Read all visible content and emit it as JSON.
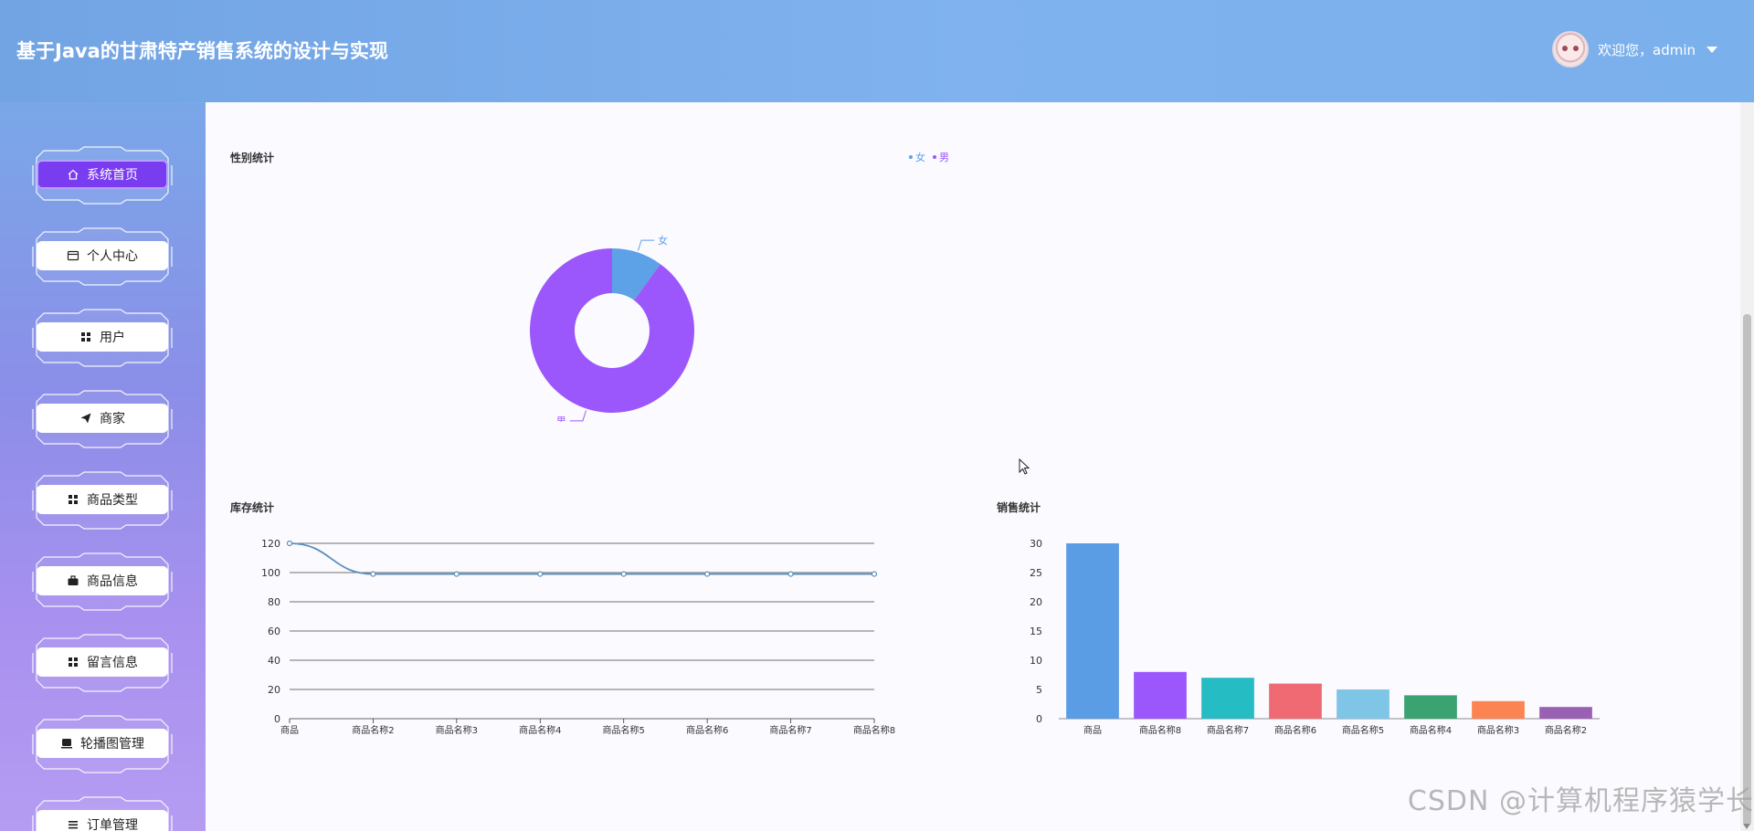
{
  "header": {
    "title": "基于Java的甘肃特产销售系统的设计与实现",
    "user_text": "欢迎您，admin"
  },
  "sidebar": {
    "items": [
      {
        "label": "系统首页",
        "icon": "home-icon",
        "active": true
      },
      {
        "label": "个人中心",
        "icon": "id-card-icon",
        "active": false
      },
      {
        "label": "用户",
        "icon": "grid-icon",
        "active": false
      },
      {
        "label": "商家",
        "icon": "paper-plane-icon",
        "active": false
      },
      {
        "label": "商品类型",
        "icon": "grid-icon",
        "active": false
      },
      {
        "label": "商品信息",
        "icon": "briefcase-icon",
        "active": false
      },
      {
        "label": "留言信息",
        "icon": "grid-icon",
        "active": false
      },
      {
        "label": "轮播图管理",
        "icon": "cup-icon",
        "active": false
      },
      {
        "label": "订单管理",
        "icon": "list-icon",
        "active": false
      }
    ]
  },
  "watermark": "CSDN @计算机程序猿学长",
  "chart_data": [
    {
      "type": "pie",
      "title": "性别统计",
      "legend": [
        "女",
        "男"
      ],
      "legend_position": "top-right",
      "labels": [
        "女",
        "男"
      ],
      "values": [
        1,
        9
      ],
      "colors": [
        "#5da2e6",
        "#9b57fb"
      ],
      "donut": true
    },
    {
      "type": "line",
      "title": "库存统计",
      "categories": [
        "商品",
        "商品名称2",
        "商品名称3",
        "商品名称4",
        "商品名称5",
        "商品名称6",
        "商品名称7",
        "商品名称8"
      ],
      "values": [
        120,
        99,
        99,
        99,
        99,
        99,
        99,
        99
      ],
      "ylim": [
        0,
        120
      ],
      "yticks": [
        0,
        20,
        40,
        60,
        80,
        100,
        120
      ],
      "smooth": true,
      "grid": true,
      "color": "#5b8fbe"
    },
    {
      "type": "bar",
      "title": "销售统计",
      "categories": [
        "商品",
        "商品名称8",
        "商品名称7",
        "商品名称6",
        "商品名称5",
        "商品名称4",
        "商品名称3",
        "商品名称2"
      ],
      "values": [
        30,
        8,
        7,
        6,
        5,
        4,
        3,
        2
      ],
      "ylim": [
        0,
        30
      ],
      "yticks": [
        0,
        5,
        10,
        15,
        20,
        25,
        30
      ],
      "colors": [
        "#5b9de4",
        "#9b57fb",
        "#26bcc4",
        "#ef6a72",
        "#7ec5e6",
        "#3ba272",
        "#fc8452",
        "#9a60b4"
      ],
      "grid": false
    }
  ]
}
